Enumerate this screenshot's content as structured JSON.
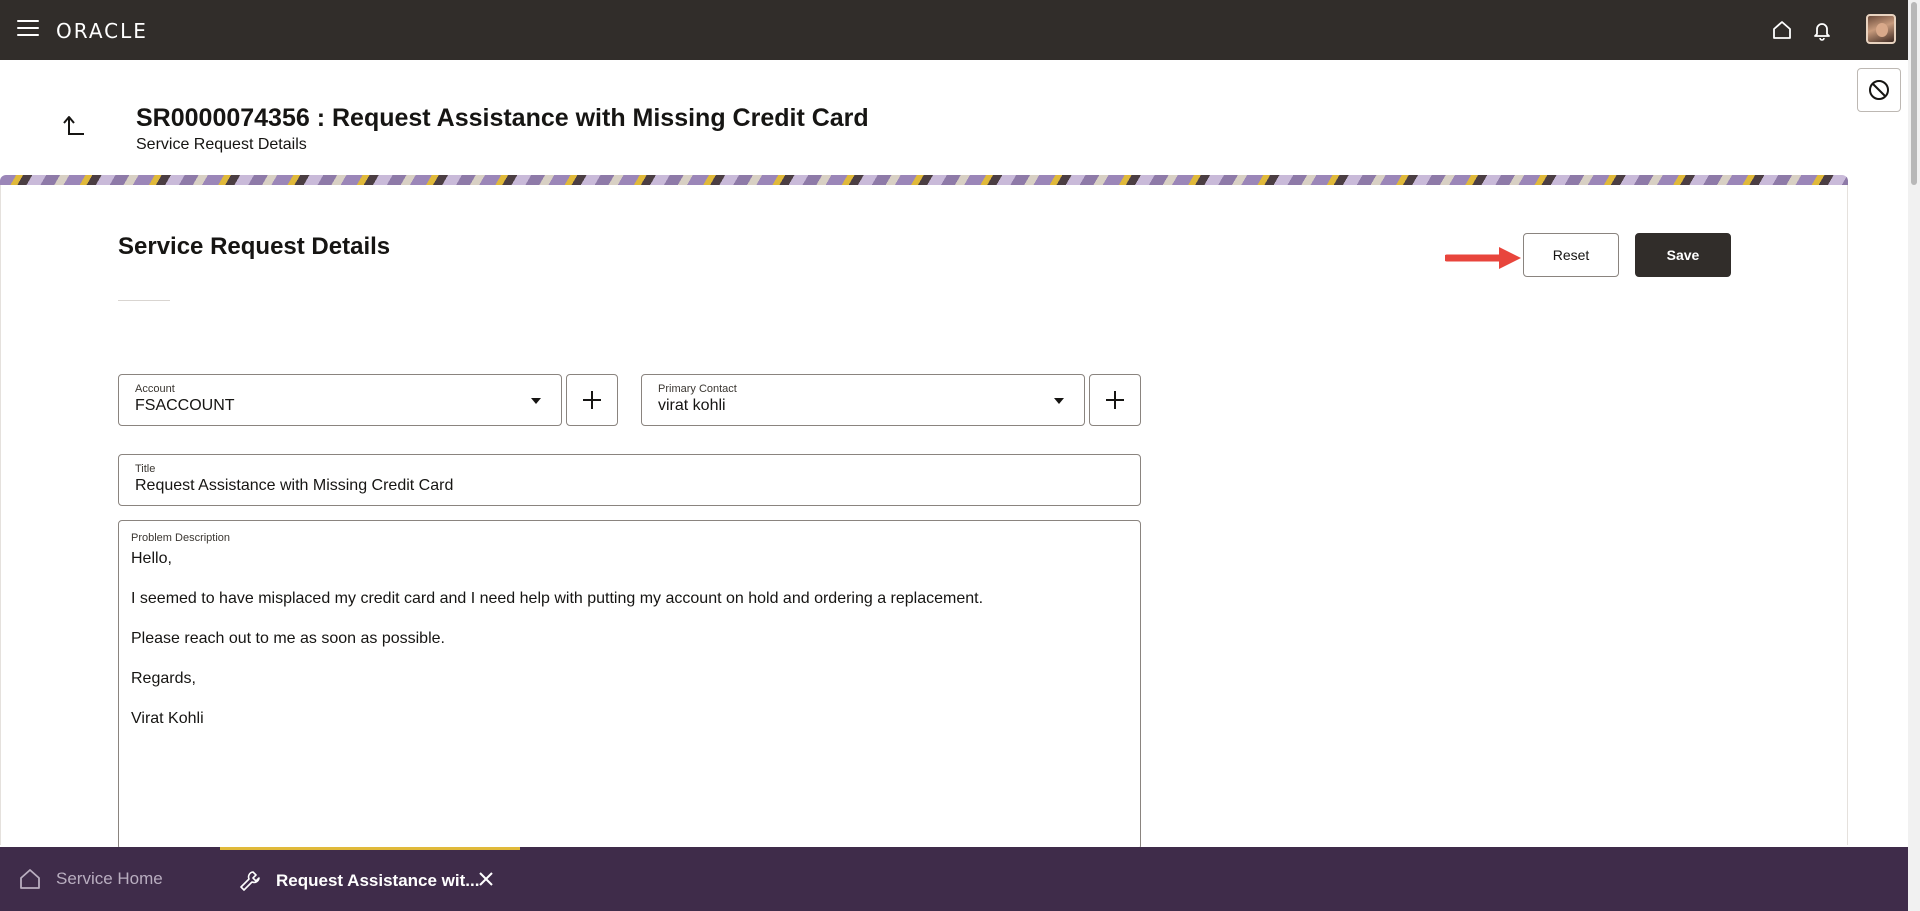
{
  "topbar": {
    "logo": "ORACLE",
    "icons": [
      "menu-icon",
      "home-icon",
      "bell-icon",
      "user-avatar"
    ]
  },
  "header": {
    "title": "SR0000074356 : Request Assistance with Missing Credit Card",
    "subtitle": "Service Request Details"
  },
  "form": {
    "section_title": "Service Request Details",
    "reset_label": "Reset",
    "save_label": "Save",
    "account": {
      "label": "Account",
      "value": "FSACCOUNT"
    },
    "primary_contact": {
      "label": "Primary Contact",
      "value": "virat kohli"
    },
    "title_field": {
      "label": "Title",
      "value": "Request Assistance with Missing Credit Card"
    },
    "problem_description": {
      "label": "Problem Description",
      "lines": [
        "Hello,",
        "I seemed to have misplaced my credit card and I need help with putting my account on hold and ordering a replacement.",
        "Please reach out to me as soon as possible.",
        "Regards,",
        "Virat Kohli"
      ]
    }
  },
  "bottom_tabs": [
    {
      "label": "Service Home",
      "icon": "home-icon",
      "active": false
    },
    {
      "label": "Request Assistance wit...",
      "icon": "wrench-icon",
      "active": true
    }
  ],
  "colors": {
    "topbar": "#312d2a",
    "bottombar": "#3f2c4a",
    "accent": "#e0b93a",
    "annotation_arrow": "#e8453c"
  }
}
